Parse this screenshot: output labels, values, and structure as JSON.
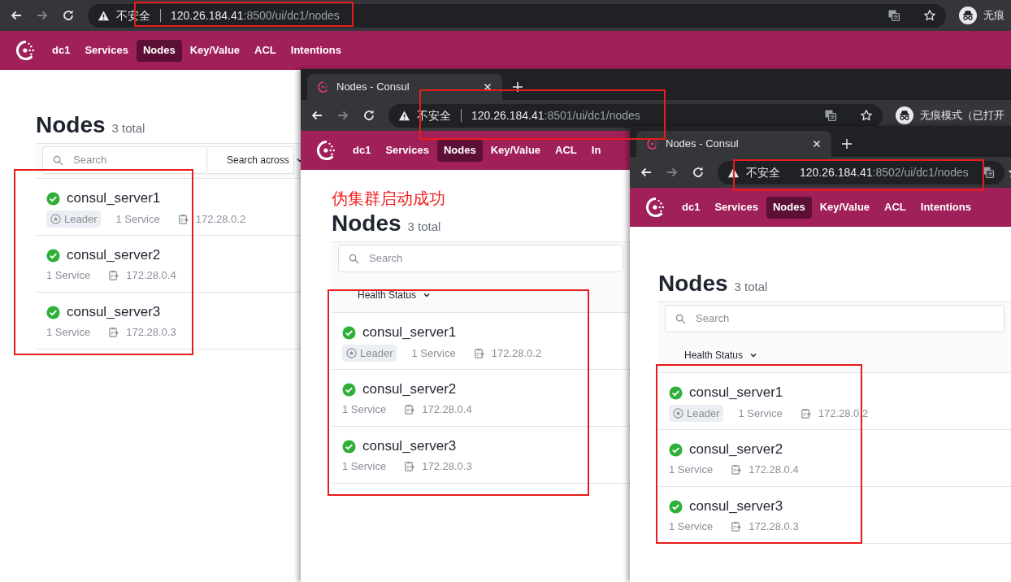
{
  "windows": [
    {
      "address": {
        "security": "不安全",
        "host": "120.26.184.41",
        "path": ":8500/ui/dc1/nodes"
      },
      "profile": "无痕",
      "nav": [
        {
          "label": "dc1",
          "selected": false
        },
        {
          "label": "Services",
          "selected": false
        },
        {
          "label": "Nodes",
          "selected": true
        },
        {
          "label": "Key/Value",
          "selected": false
        },
        {
          "label": "ACL",
          "selected": false
        },
        {
          "label": "Intentions",
          "selected": false
        }
      ],
      "title": "Nodes",
      "count": "3 total",
      "search": {
        "placeholder": "Search",
        "scope": "Search across"
      },
      "nodes": [
        {
          "name": "consul_server1",
          "healthy": true,
          "badge": "Leader",
          "services": "1 Service",
          "ip": "172.28.0.2"
        },
        {
          "name": "consul_server2",
          "healthy": true,
          "services": "1 Service",
          "ip": "172.28.0.4"
        },
        {
          "name": "consul_server3",
          "healthy": true,
          "services": "1 Service",
          "ip": "172.28.0.3"
        }
      ]
    },
    {
      "tab": "Nodes - Consul",
      "address": {
        "security": "不安全",
        "host": "120.26.184.41",
        "path": ":8501/ui/dc1/nodes"
      },
      "profile": "无痕模式（已打开",
      "nav": [
        {
          "label": "dc1",
          "selected": false
        },
        {
          "label": "Services",
          "selected": false
        },
        {
          "label": "Nodes",
          "selected": true
        },
        {
          "label": "Key/Value",
          "selected": false
        },
        {
          "label": "ACL",
          "selected": false
        },
        {
          "label": "In",
          "selected": false
        }
      ],
      "note": "伪集群启动成功",
      "title": "Nodes",
      "count": "3 total",
      "search": {
        "placeholder": "Search"
      },
      "filter": "Health Status",
      "nodes": [
        {
          "name": "consul_server1",
          "healthy": true,
          "badge": "Leader",
          "services": "1 Service",
          "ip": "172.28.0.2"
        },
        {
          "name": "consul_server2",
          "healthy": true,
          "services": "1 Service",
          "ip": "172.28.0.4"
        },
        {
          "name": "consul_server3",
          "healthy": true,
          "services": "1 Service",
          "ip": "172.28.0.3"
        }
      ]
    },
    {
      "tab": "Nodes - Consul",
      "address": {
        "security": "不安全",
        "host": "120.26.184.41",
        "path": ":8502/ui/dc1/nodes"
      },
      "nav": [
        {
          "label": "dc1",
          "selected": false
        },
        {
          "label": "Services",
          "selected": false
        },
        {
          "label": "Nodes",
          "selected": true
        },
        {
          "label": "Key/Value",
          "selected": false
        },
        {
          "label": "ACL",
          "selected": false
        },
        {
          "label": "Intentions",
          "selected": false
        }
      ],
      "title": "Nodes",
      "count": "3 total",
      "search": {
        "placeholder": "Search"
      },
      "filter": "Health Status",
      "nodes": [
        {
          "name": "consul_server1",
          "healthy": true,
          "badge": "Leader",
          "services": "1 Service",
          "ip": "172.28.0.2"
        },
        {
          "name": "consul_server2",
          "healthy": true,
          "services": "1 Service",
          "ip": "172.28.0.4"
        },
        {
          "name": "consul_server3",
          "healthy": true,
          "services": "1 Service",
          "ip": "172.28.0.3"
        }
      ]
    }
  ]
}
